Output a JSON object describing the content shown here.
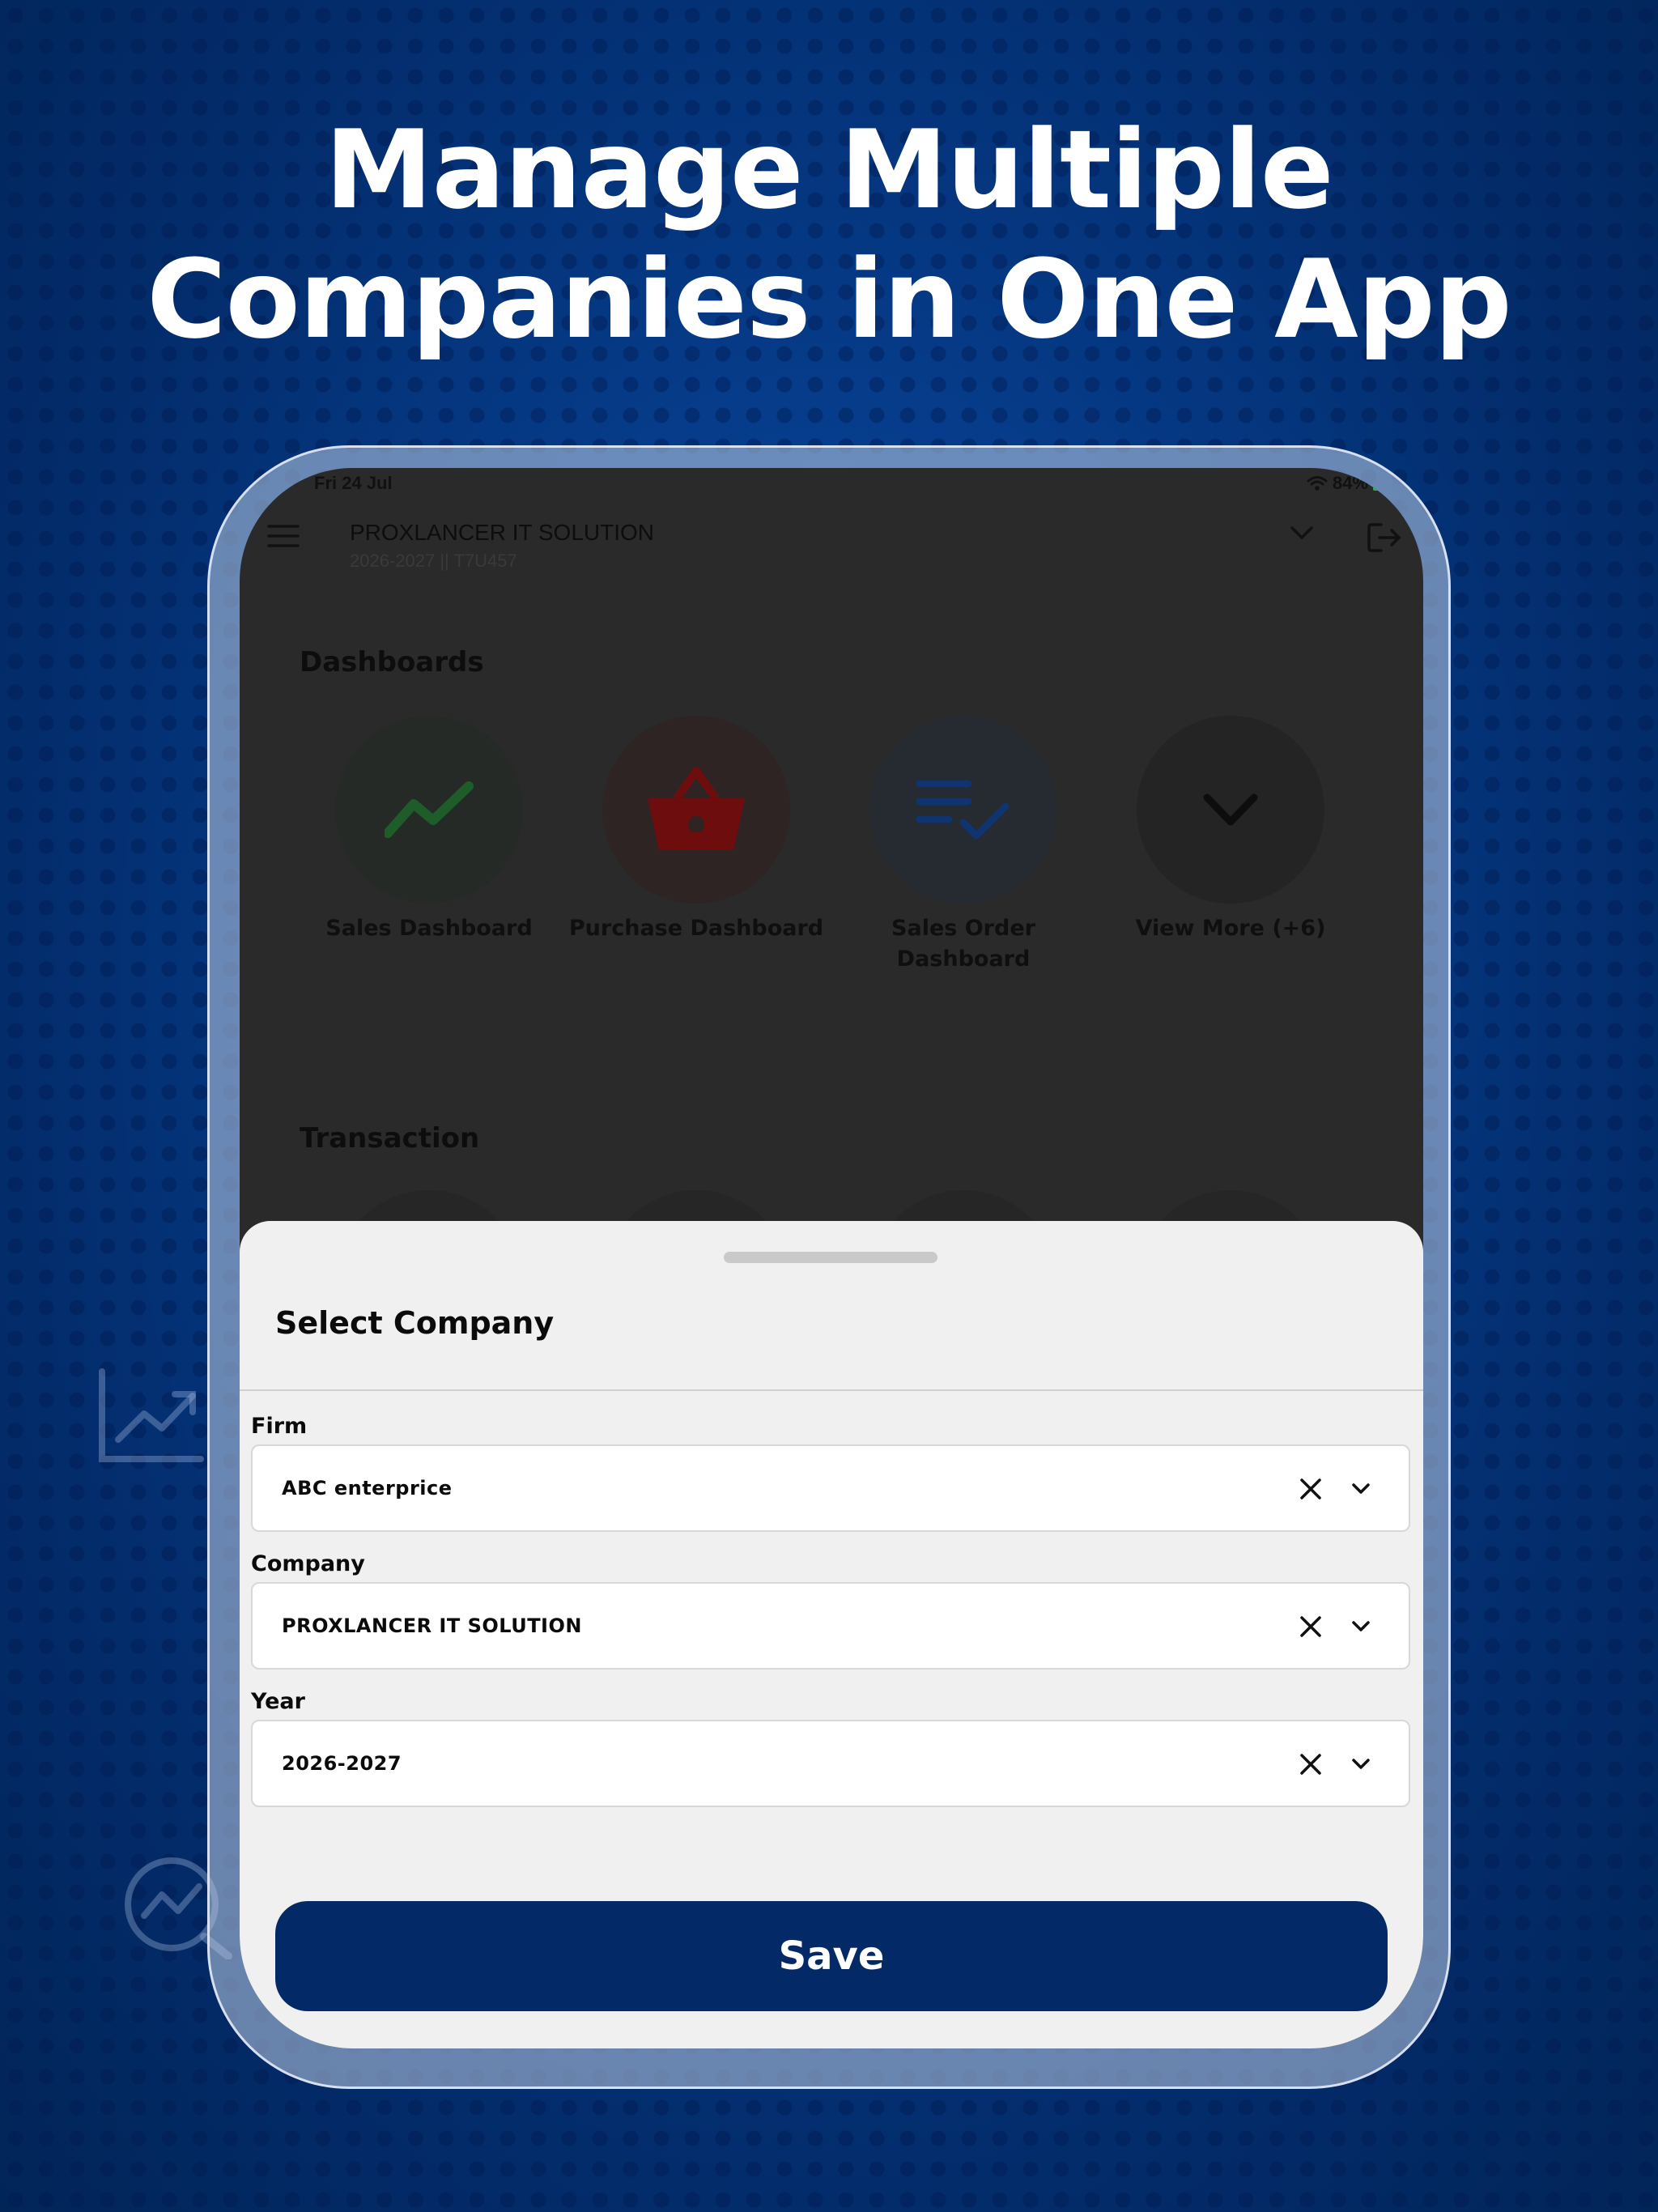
{
  "headline": {
    "line1": "Manage Multiple",
    "line2": "Companies in One App"
  },
  "status_bar": {
    "date": "Fri 24 Jul",
    "battery": "84%"
  },
  "app_header": {
    "company": "PROXLANCER IT SOLUTION",
    "subtitle": "2026-2027 || T7U457"
  },
  "dashboards": {
    "title": "Dashboards",
    "items": [
      {
        "label": "Sales Dashboard",
        "icon": "trending-up-icon",
        "color": "#1e5c2a"
      },
      {
        "label": "Purchase Dashboard",
        "icon": "basket-icon",
        "color": "#6e0d0d"
      },
      {
        "label": "Sales Order Dashboard",
        "icon": "list-check-icon",
        "color": "#0f3470"
      },
      {
        "label": "View More (+6)",
        "icon": "chevron-down-icon",
        "color": "#0d0d0d"
      }
    ]
  },
  "transaction": {
    "title": "Transaction"
  },
  "sheet": {
    "title": "Select Company",
    "fields": [
      {
        "label": "Firm",
        "value": "ABC enterprice"
      },
      {
        "label": "Company",
        "value": "PROXLANCER IT SOLUTION"
      },
      {
        "label": "Year",
        "value": "2026-2027"
      }
    ],
    "save_label": "Save"
  },
  "colors": {
    "primary": "#032a66",
    "background": "#063c8a",
    "overlay": "#2a2a2a"
  }
}
